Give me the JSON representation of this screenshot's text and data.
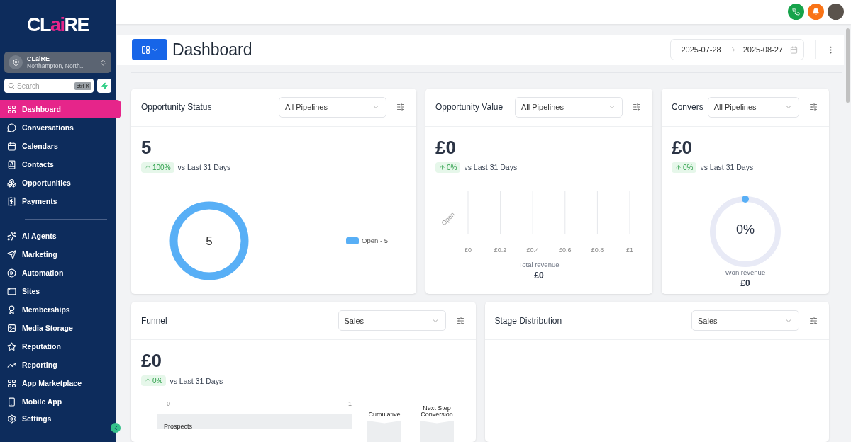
{
  "sidebar": {
    "logo": {
      "start": "CL",
      "accent": "ai",
      "end": "RE"
    },
    "account": {
      "name": "CLaiRE",
      "location": "Northampton, North..."
    },
    "search": {
      "placeholder": "Search",
      "shortcut": "ctrl K"
    },
    "nav_groups": [
      {
        "items": [
          {
            "label": "Dashboard",
            "selected": true
          },
          {
            "label": "Conversations",
            "selected": false
          },
          {
            "label": "Calendars",
            "selected": false
          },
          {
            "label": "Contacts",
            "selected": false
          },
          {
            "label": "Opportunities",
            "selected": false
          },
          {
            "label": "Payments",
            "selected": false
          }
        ]
      },
      {
        "items": [
          {
            "label": "AI Agents",
            "selected": false
          },
          {
            "label": "Marketing",
            "selected": false
          },
          {
            "label": "Automation",
            "selected": false
          },
          {
            "label": "Sites",
            "selected": false
          },
          {
            "label": "Memberships",
            "selected": false
          },
          {
            "label": "Media Storage",
            "selected": false
          },
          {
            "label": "Reputation",
            "selected": false
          },
          {
            "label": "Reporting",
            "selected": false
          },
          {
            "label": "App Marketplace",
            "selected": false
          },
          {
            "label": "Mobile App",
            "selected": false
          },
          {
            "label": "Settings",
            "selected": false
          }
        ]
      }
    ]
  },
  "header": {
    "title": "Dashboard",
    "date_from": "2025-07-28",
    "date_to": "2025-08-27"
  },
  "cards": [
    {
      "kind": "donut",
      "title": "Opportunity Status",
      "filter": "All Pipelines",
      "value": "5",
      "change": "100%",
      "comparison": "vs Last 31 Days",
      "center": "5",
      "legend": "Open - 5"
    },
    {
      "kind": "bar",
      "title": "Opportunity Value",
      "filter": "All Pipelines",
      "value": "£0",
      "change": "0%",
      "comparison": "vs Last 31 Days",
      "total_label": "Total revenue",
      "total_value": "£0",
      "chart_data": {
        "type": "bar",
        "orientation": "horizontal",
        "grid": true,
        "categories": [
          "Open"
        ],
        "values": [
          0
        ],
        "xlim": [
          0,
          1
        ],
        "xticks": [
          {
            "value": 0,
            "label": "£0"
          },
          {
            "value": 0.2,
            "label": "£0.2"
          },
          {
            "value": 0.4,
            "label": "£0.4"
          },
          {
            "value": 0.6,
            "label": "£0.6"
          },
          {
            "value": 0.8,
            "label": "£0.8"
          },
          {
            "value": 1,
            "label": "£1"
          }
        ]
      }
    },
    {
      "kind": "gauge",
      "title": "Convers",
      "filter": "All Pipelines",
      "value": "£0",
      "change": "0%",
      "comparison": "vs Last 31 Days",
      "center": "0%",
      "level": 0,
      "total_label": "Won revenue",
      "total_value": "£0"
    },
    {
      "kind": "funnel",
      "title": "Funnel",
      "filter": "Sales",
      "value": "£0",
      "change": "0%",
      "comparison": "vs Last 31 Days",
      "axis_start": "0",
      "axis_end": "1",
      "stage": "Prospects",
      "columns": [
        "Cumulative",
        "Next Step Conversion"
      ]
    },
    {
      "kind": "empty",
      "title": "Stage Distribution",
      "filter": "Sales"
    }
  ]
}
